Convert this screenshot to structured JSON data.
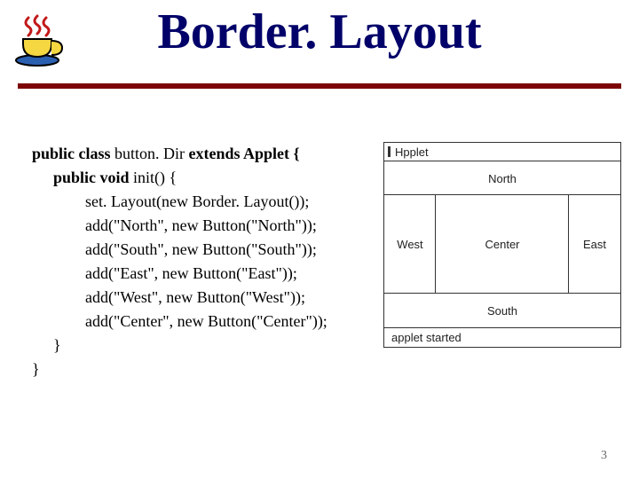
{
  "header": {
    "title": "Border. Layout"
  },
  "code": {
    "l1a": "public class ",
    "l1b": "button. Dir ",
    "l1c": "extends Applet {",
    "l2a": "public void ",
    "l2b": "init() {",
    "l3": "set. Layout(new Border. Layout());",
    "l4": "add(\"North\", new Button(\"North\"));",
    "l5": "add(\"South\", new Button(\"South\"));",
    "l6": "add(\"East\", new Button(\"East\"));",
    "l7": "add(\"West\", new Button(\"West\"));",
    "l8": "add(\"Center\", new Button(\"Center\"));",
    "l9": "}",
    "l10": "}"
  },
  "applet": {
    "window_label": "Hpplet",
    "north": "North",
    "south": "South",
    "east": "East",
    "west": "West",
    "center": "Center",
    "status": "applet started"
  },
  "page_number": "3"
}
